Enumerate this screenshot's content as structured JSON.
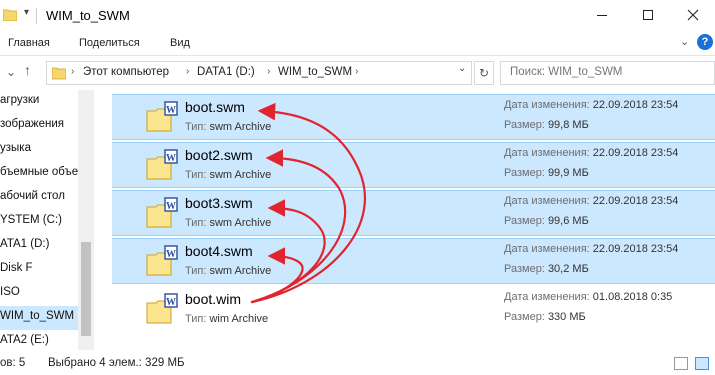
{
  "window": {
    "title": "WIM_to_SWM"
  },
  "ribbon": {
    "tabs": [
      "Главная",
      "Поделиться",
      "Вид"
    ]
  },
  "address": {
    "segments": [
      "Этот компьютер",
      "DATA1 (D:)",
      "WIM_to_SWM"
    ]
  },
  "search": {
    "placeholder": "Поиск: WIM_to_SWM"
  },
  "navpane": {
    "items": [
      {
        "label": "агрузки",
        "selected": false
      },
      {
        "label": "зображения",
        "selected": false
      },
      {
        "label": "узыка",
        "selected": false
      },
      {
        "label": "бъемные объе",
        "selected": false
      },
      {
        "label": "абочий стол",
        "selected": false
      },
      {
        "label": "YSTEM (C:)",
        "selected": false
      },
      {
        "label": "ATA1 (D:)",
        "selected": false
      },
      {
        "label": "Disk F",
        "selected": false
      },
      {
        "label": "ISO",
        "selected": false
      },
      {
        "label": "WIM_to_SWM",
        "selected": true
      },
      {
        "label": "ATA2 (E:)",
        "selected": false
      }
    ]
  },
  "labels": {
    "type": "Тип:",
    "date": "Дата изменения:",
    "size": "Размер:"
  },
  "files": [
    {
      "name": "boot.swm",
      "type": "swm Archive",
      "date": "22.09.2018 23:54",
      "size": "99,8 МБ",
      "selected": true
    },
    {
      "name": "boot2.swm",
      "type": "swm Archive",
      "date": "22.09.2018 23:54",
      "size": "99,9 МБ",
      "selected": true
    },
    {
      "name": "boot3.swm",
      "type": "swm Archive",
      "date": "22.09.2018 23:54",
      "size": "99,6 МБ",
      "selected": true
    },
    {
      "name": "boot4.swm",
      "type": "swm Archive",
      "date": "22.09.2018 23:54",
      "size": "30,2 МБ",
      "selected": true
    },
    {
      "name": "boot.wim",
      "type": "wim Archive",
      "date": "01.08.2018 0:35",
      "size": "330 МБ",
      "selected": false
    }
  ],
  "status": {
    "count": "ов: 5",
    "selection": "Выбрано 4 элем.: 329 МБ"
  },
  "colors": {
    "selection": "#cce8ff",
    "selection_border": "#99d1ff",
    "arrow": "#e0252f",
    "folder": "#fbe58f"
  }
}
